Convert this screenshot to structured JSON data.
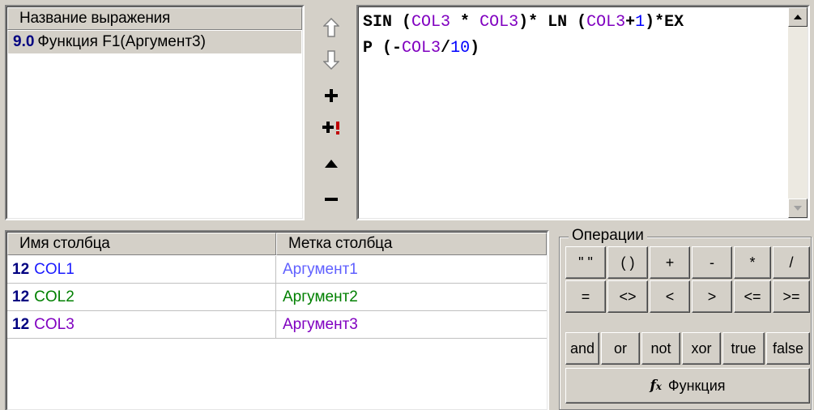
{
  "expressions": {
    "header": "Название выражения",
    "rows": [
      {
        "num": "9.0",
        "name": "Функция F1(Аргумент3)"
      }
    ]
  },
  "toolbar": {
    "items": [
      "move-up",
      "move-down",
      "add",
      "add-copy",
      "expand",
      "remove"
    ]
  },
  "editor": {
    "line1": [
      {
        "t": "SIN ",
        "k": "kw"
      },
      {
        "t": "(",
        "k": "plain"
      },
      {
        "t": "COL3",
        "k": "col"
      },
      {
        "t": " * ",
        "k": "kw"
      },
      {
        "t": "COL3",
        "k": "col"
      },
      {
        "t": ")* ",
        "k": "kw"
      },
      {
        "t": "LN ",
        "k": "kw"
      },
      {
        "t": "(",
        "k": "plain"
      },
      {
        "t": "COL3",
        "k": "col"
      },
      {
        "t": "+",
        "k": "kw"
      },
      {
        "t": "1",
        "k": "num"
      },
      {
        "t": ")*EX",
        "k": "kw"
      }
    ],
    "line2": [
      {
        "t": "P ",
        "k": "kw"
      },
      {
        "t": "(-",
        "k": "plain"
      },
      {
        "t": "COL3",
        "k": "col"
      },
      {
        "t": "/",
        "k": "kw"
      },
      {
        "t": "10",
        "k": "num"
      },
      {
        "t": ")",
        "k": "plain"
      }
    ]
  },
  "columns": {
    "header_name": "Имя столбца",
    "header_label": "Метка столбца",
    "rows": [
      {
        "num": "12",
        "name": "COL1",
        "label": "Аргумент1",
        "name_color": "#1a1aff",
        "label_color": "#6060ff"
      },
      {
        "num": "12",
        "name": "COL2",
        "label": "Аргумент2",
        "name_color": "#008000",
        "label_color": "#008000"
      },
      {
        "num": "12",
        "name": "COL3",
        "label": "Аргумент3",
        "name_color": "#8000c0",
        "label_color": "#8000c0"
      }
    ]
  },
  "operations": {
    "title": "Операции",
    "row1": [
      "\" \"",
      "( )",
      "+",
      "-",
      "*",
      "/"
    ],
    "row2": [
      "=",
      "<>",
      "<",
      ">",
      "<=",
      ">="
    ],
    "row3": [
      "and",
      "or",
      "not",
      "xor",
      "true",
      "false"
    ],
    "function_label": "Функция"
  },
  "colors": {
    "background": "#d4d0c8",
    "keyword": "#000000",
    "column_ref": "#8000c0",
    "number": "#0000ff"
  }
}
